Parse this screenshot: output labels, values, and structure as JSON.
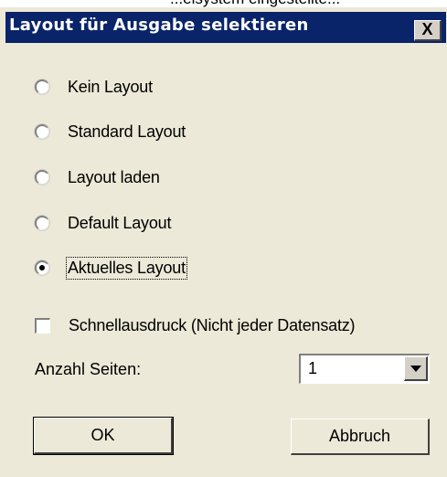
{
  "window": {
    "clipped_title": "...elsystem eingestellte...",
    "title": "Layout für Ausgabe selektieren",
    "close_label": "X"
  },
  "options": [
    {
      "label": "Kein Layout",
      "selected": false
    },
    {
      "label": "Standard Layout",
      "selected": false
    },
    {
      "label": "Layout laden",
      "selected": false
    },
    {
      "label": "Default Layout",
      "selected": false
    },
    {
      "label": "Aktuelles Layout",
      "selected": true
    }
  ],
  "quick_print": {
    "label": "Schnellausdruck (Nicht jeder Datensatz)",
    "checked": false
  },
  "pages": {
    "label": "Anzahl Seiten:",
    "value": "1"
  },
  "buttons": {
    "ok": "OK",
    "cancel": "Abbruch"
  },
  "colors": {
    "titlebar": "#0a246a",
    "dialog_bg": "#ece9d8"
  },
  "icons": {
    "close": "close-icon",
    "dropdown": "chevron-down-icon"
  }
}
